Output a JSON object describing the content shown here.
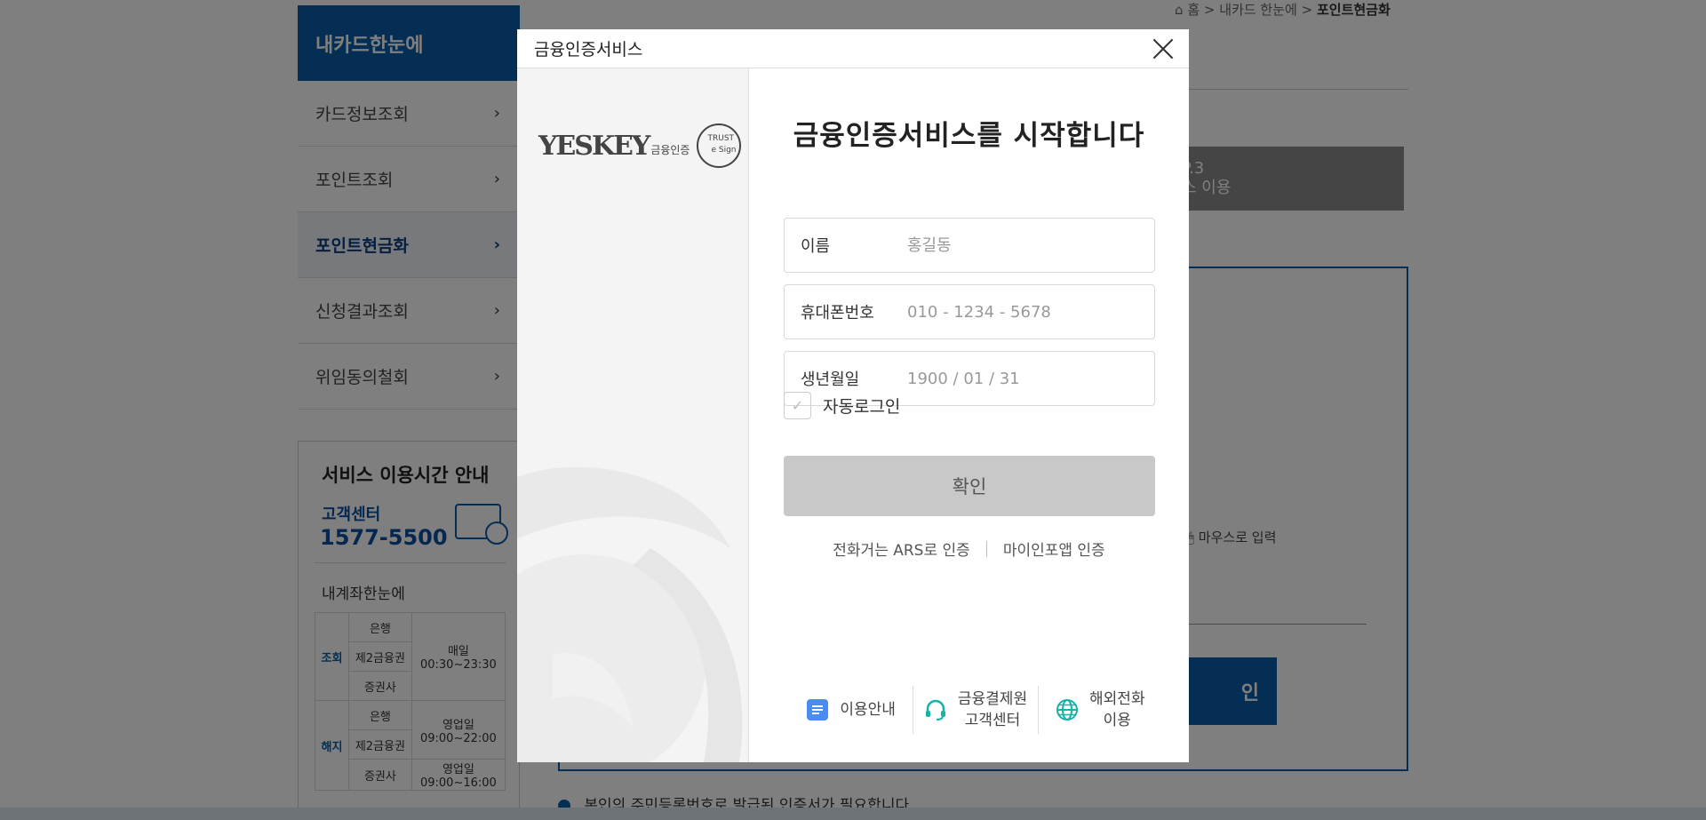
{
  "background": {
    "breadcrumb": {
      "home_label": "홈",
      "level1": "내카드 한눈에",
      "current": "포인트현금화",
      "separator": ">"
    },
    "lnb": {
      "title": "내카드한눈에",
      "items": [
        {
          "label": "카드정보조회",
          "active": false
        },
        {
          "label": "포인트조회",
          "active": false
        },
        {
          "label": "포인트현금화",
          "active": true
        },
        {
          "label": "신청결과조회",
          "active": false
        },
        {
          "label": "위임동의철회",
          "active": false
        }
      ],
      "chevron": "›"
    },
    "service_hours": {
      "title": "서비스 이용시간 안내",
      "center_label": "고객센터",
      "center_phone": "1577-5500",
      "subtitle": "내계좌한눈에",
      "rows": [
        {
          "group": "조회",
          "org": "은행",
          "time": "매일\n00:30~23:30"
        },
        {
          "org": "제2금융권"
        },
        {
          "org": "증권사"
        },
        {
          "group": "해지",
          "org": "은행",
          "time": "영업일\n09:00~22:00"
        },
        {
          "org": "제2금융권"
        },
        {
          "org": "증권사",
          "time": "영업일\n09:00~16:00"
        }
      ]
    },
    "step_box": {
      "line1": "P.3",
      "line2": "스 이용"
    },
    "mouse_input_label": "마우스로 입력",
    "confirm_partial": "인",
    "bottom_note": "본인의 주민등록번호로 발급된 인증서가 필요합니다."
  },
  "modal": {
    "title": "금융인증서비스",
    "brand": {
      "name": "YESKEY",
      "sub": "금융인증",
      "seal_top": "TRUST",
      "seal_bottom": "e Sign"
    },
    "headline": "금융인증서비스를 시작합니다",
    "fields": [
      {
        "label": "이름",
        "placeholder": "홍길동"
      },
      {
        "label": "휴대폰번호",
        "placeholder": "010 - 1234 - 5678"
      },
      {
        "label": "생년월일",
        "placeholder": "1900 / 01 / 31"
      }
    ],
    "auto_login": {
      "label": "자동로그인",
      "checked": false,
      "check_glyph": "✓"
    },
    "confirm_label": "확인",
    "alt_links": [
      "전화거는 ARS로 인증",
      "마이인포앱 인증"
    ],
    "footer": [
      {
        "label": "이용안내",
        "icon": "document-icon"
      },
      {
        "label": "금융결제원\n고객센터",
        "icon": "headset-icon"
      },
      {
        "label": "해외전화\n이용",
        "icon": "globe-icon"
      }
    ]
  }
}
